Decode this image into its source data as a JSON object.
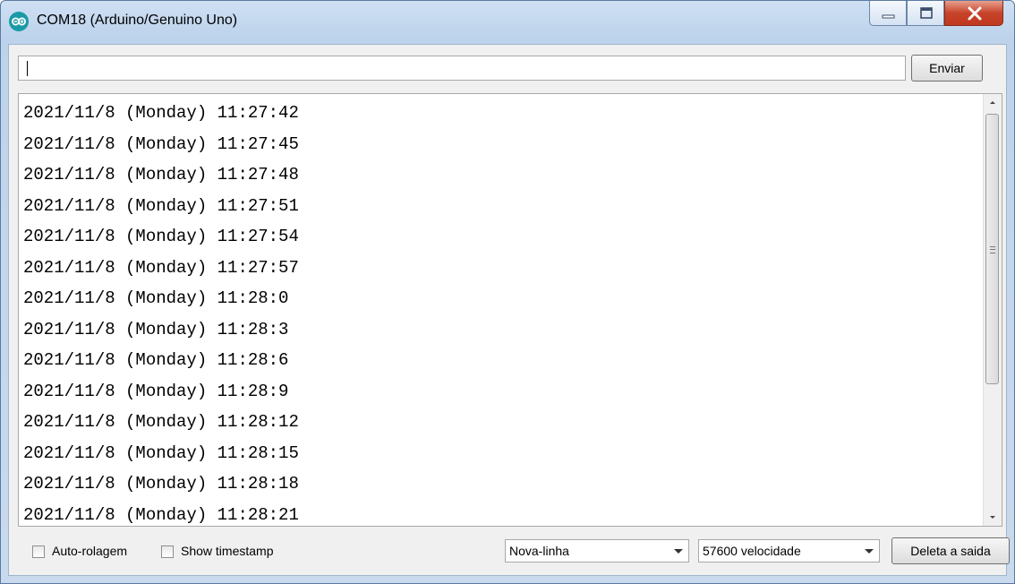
{
  "window": {
    "title": "COM18 (Arduino/Genuino Uno)",
    "buttons": [
      "minimize",
      "maximize",
      "close"
    ]
  },
  "send": {
    "input_value": "",
    "button_label": "Enviar"
  },
  "output": {
    "lines": [
      "2021/11/8 (Monday) 11:27:42",
      "2021/11/8 (Monday) 11:27:45",
      "2021/11/8 (Monday) 11:27:48",
      "2021/11/8 (Monday) 11:27:51",
      "2021/11/8 (Monday) 11:27:54",
      "2021/11/8 (Monday) 11:27:57",
      "2021/11/8 (Monday) 11:28:0",
      "2021/11/8 (Monday) 11:28:3",
      "2021/11/8 (Monday) 11:28:6",
      "2021/11/8 (Monday) 11:28:9",
      "2021/11/8 (Monday) 11:28:12",
      "2021/11/8 (Monday) 11:28:15",
      "2021/11/8 (Monday) 11:28:18",
      "2021/11/8 (Monday) 11:28:21"
    ]
  },
  "footer": {
    "autoscroll_label": "Auto-rolagem",
    "autoscroll_checked": false,
    "timestamp_label": "Show timestamp",
    "timestamp_checked": false,
    "line_ending": "Nova-linha",
    "baud_rate": "57600 velocidade",
    "clear_label": "Deleta a saida"
  },
  "colors": {
    "app_icon": "#1a9aa6",
    "close_button": "#c7432b"
  }
}
